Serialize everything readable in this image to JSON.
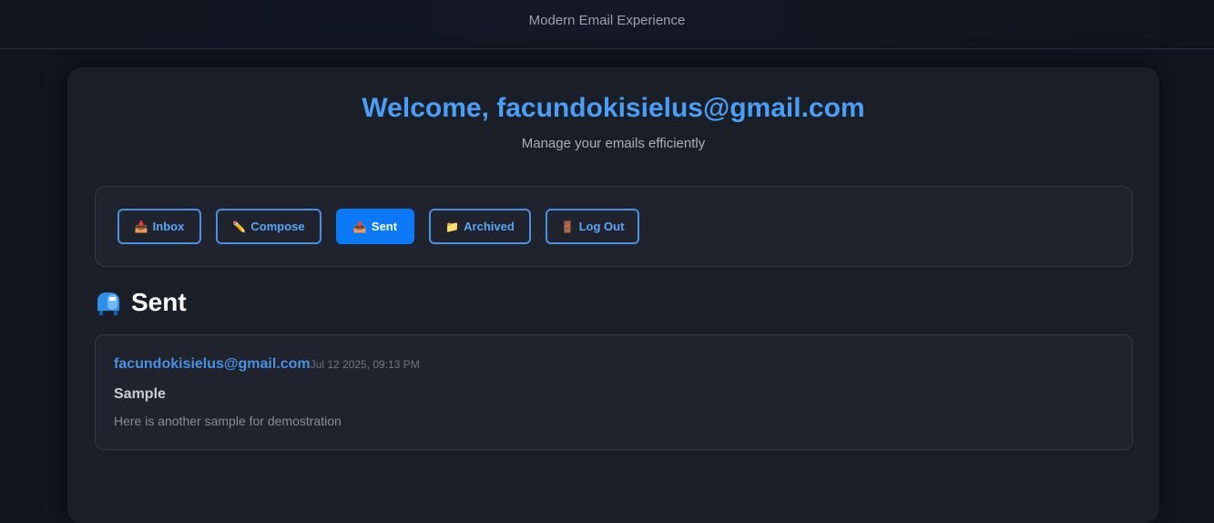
{
  "header": {
    "title": "Modern Email Experience"
  },
  "welcome": {
    "heading": "Welcome, facundokisielus@gmail.com",
    "subtitle": "Manage your emails efficiently"
  },
  "nav": {
    "items": [
      {
        "icon": "📥",
        "label": "Inbox",
        "active": false
      },
      {
        "icon": "✏️",
        "label": "Compose",
        "active": false
      },
      {
        "icon": "📤",
        "label": "Sent",
        "active": true
      },
      {
        "icon": "📁",
        "label": "Archived",
        "active": false
      },
      {
        "icon": "🚪",
        "label": "Log Out",
        "active": false
      }
    ]
  },
  "section": {
    "icon": "mailbox-icon",
    "title": "Sent"
  },
  "emails": [
    {
      "from": "facundokisielus@gmail.com",
      "date": "Jul 12 2025, 09:13 PM",
      "subject": "Sample",
      "preview": "Here is another sample for demostration"
    }
  ],
  "colors": {
    "accent": "#4a9ef5",
    "active_button": "#0b79f5",
    "background": "#111520",
    "card": "#1a1e27"
  }
}
